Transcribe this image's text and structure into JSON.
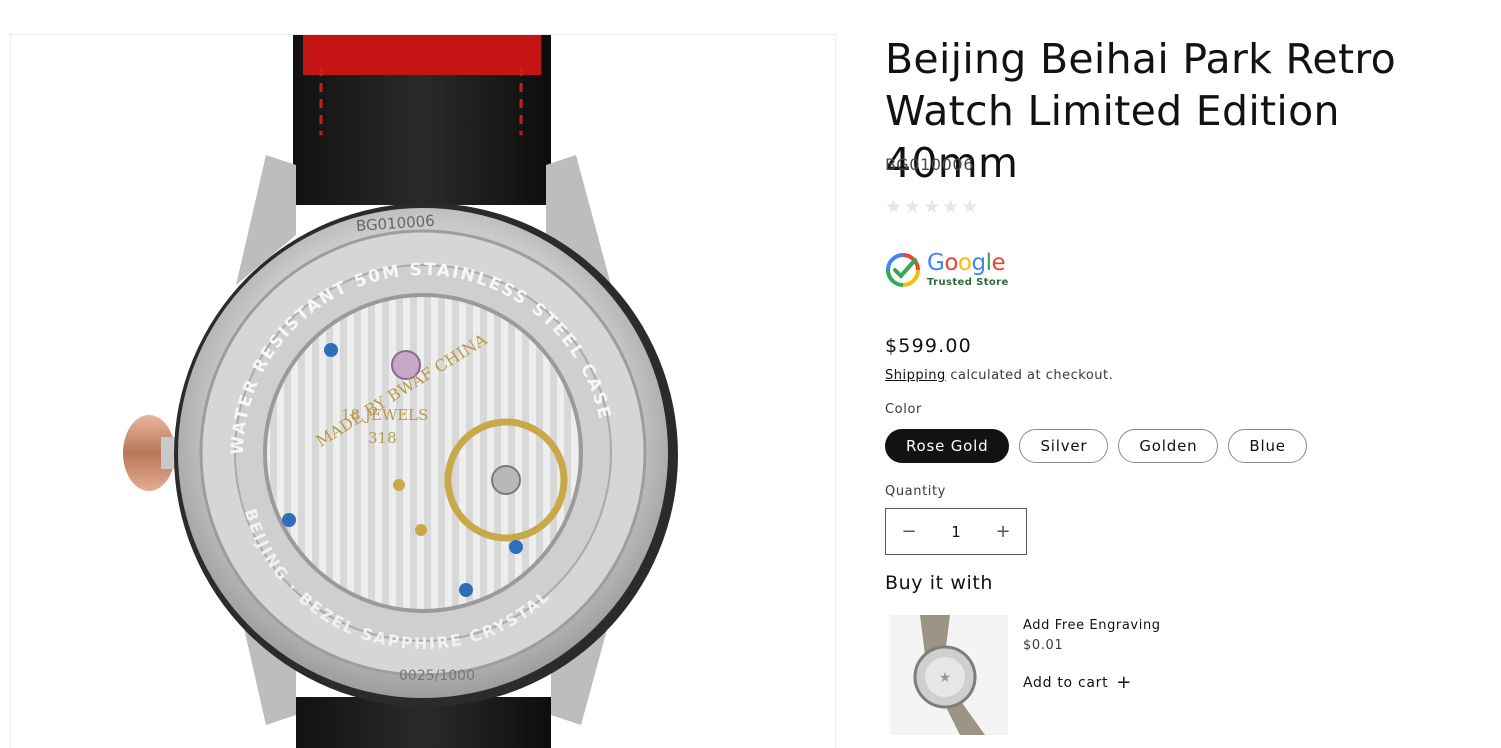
{
  "product": {
    "title": "Beijing Beihai Park Retro Watch Limited Edition 40mm",
    "sku": "BG010006",
    "rating_stars": 5,
    "price": "$599.00",
    "shipping_link": "Shipping",
    "shipping_text": " calculated at checkout."
  },
  "badge": {
    "google_word": "Google",
    "trusted_text": "Trusted Store"
  },
  "color": {
    "label": "Color",
    "options": [
      "Rose Gold",
      "Silver",
      "Golden",
      "Blue"
    ],
    "selected": "Rose Gold"
  },
  "quantity": {
    "label": "Quantity",
    "value": "1",
    "minus": "−",
    "plus": "+"
  },
  "buy_it_with": {
    "heading": "Buy it with",
    "item_title": "Add Free Engraving",
    "item_price": "$0.01",
    "add_to_cart": "Add to cart",
    "add_icon": "+"
  },
  "image_text": {
    "case_sku": "BG010006",
    "ring_text": "WATER RESISTANT 50M STAINLESS STEEL CASE",
    "ring_text_bottom": "BEIJING · BEZEL SAPPHIRE CRYSTAL",
    "made_by": "MADE BY BWAF CHINA",
    "jewels": "18 JEWELS",
    "caliber": "318",
    "edition": "0025/1000"
  },
  "colors": {
    "accent": "#121212",
    "strap_red": "#d11a1a",
    "google_blue": "#4285F4",
    "google_red": "#EA4335",
    "google_yellow": "#FBBC05",
    "google_green": "#34A853"
  }
}
